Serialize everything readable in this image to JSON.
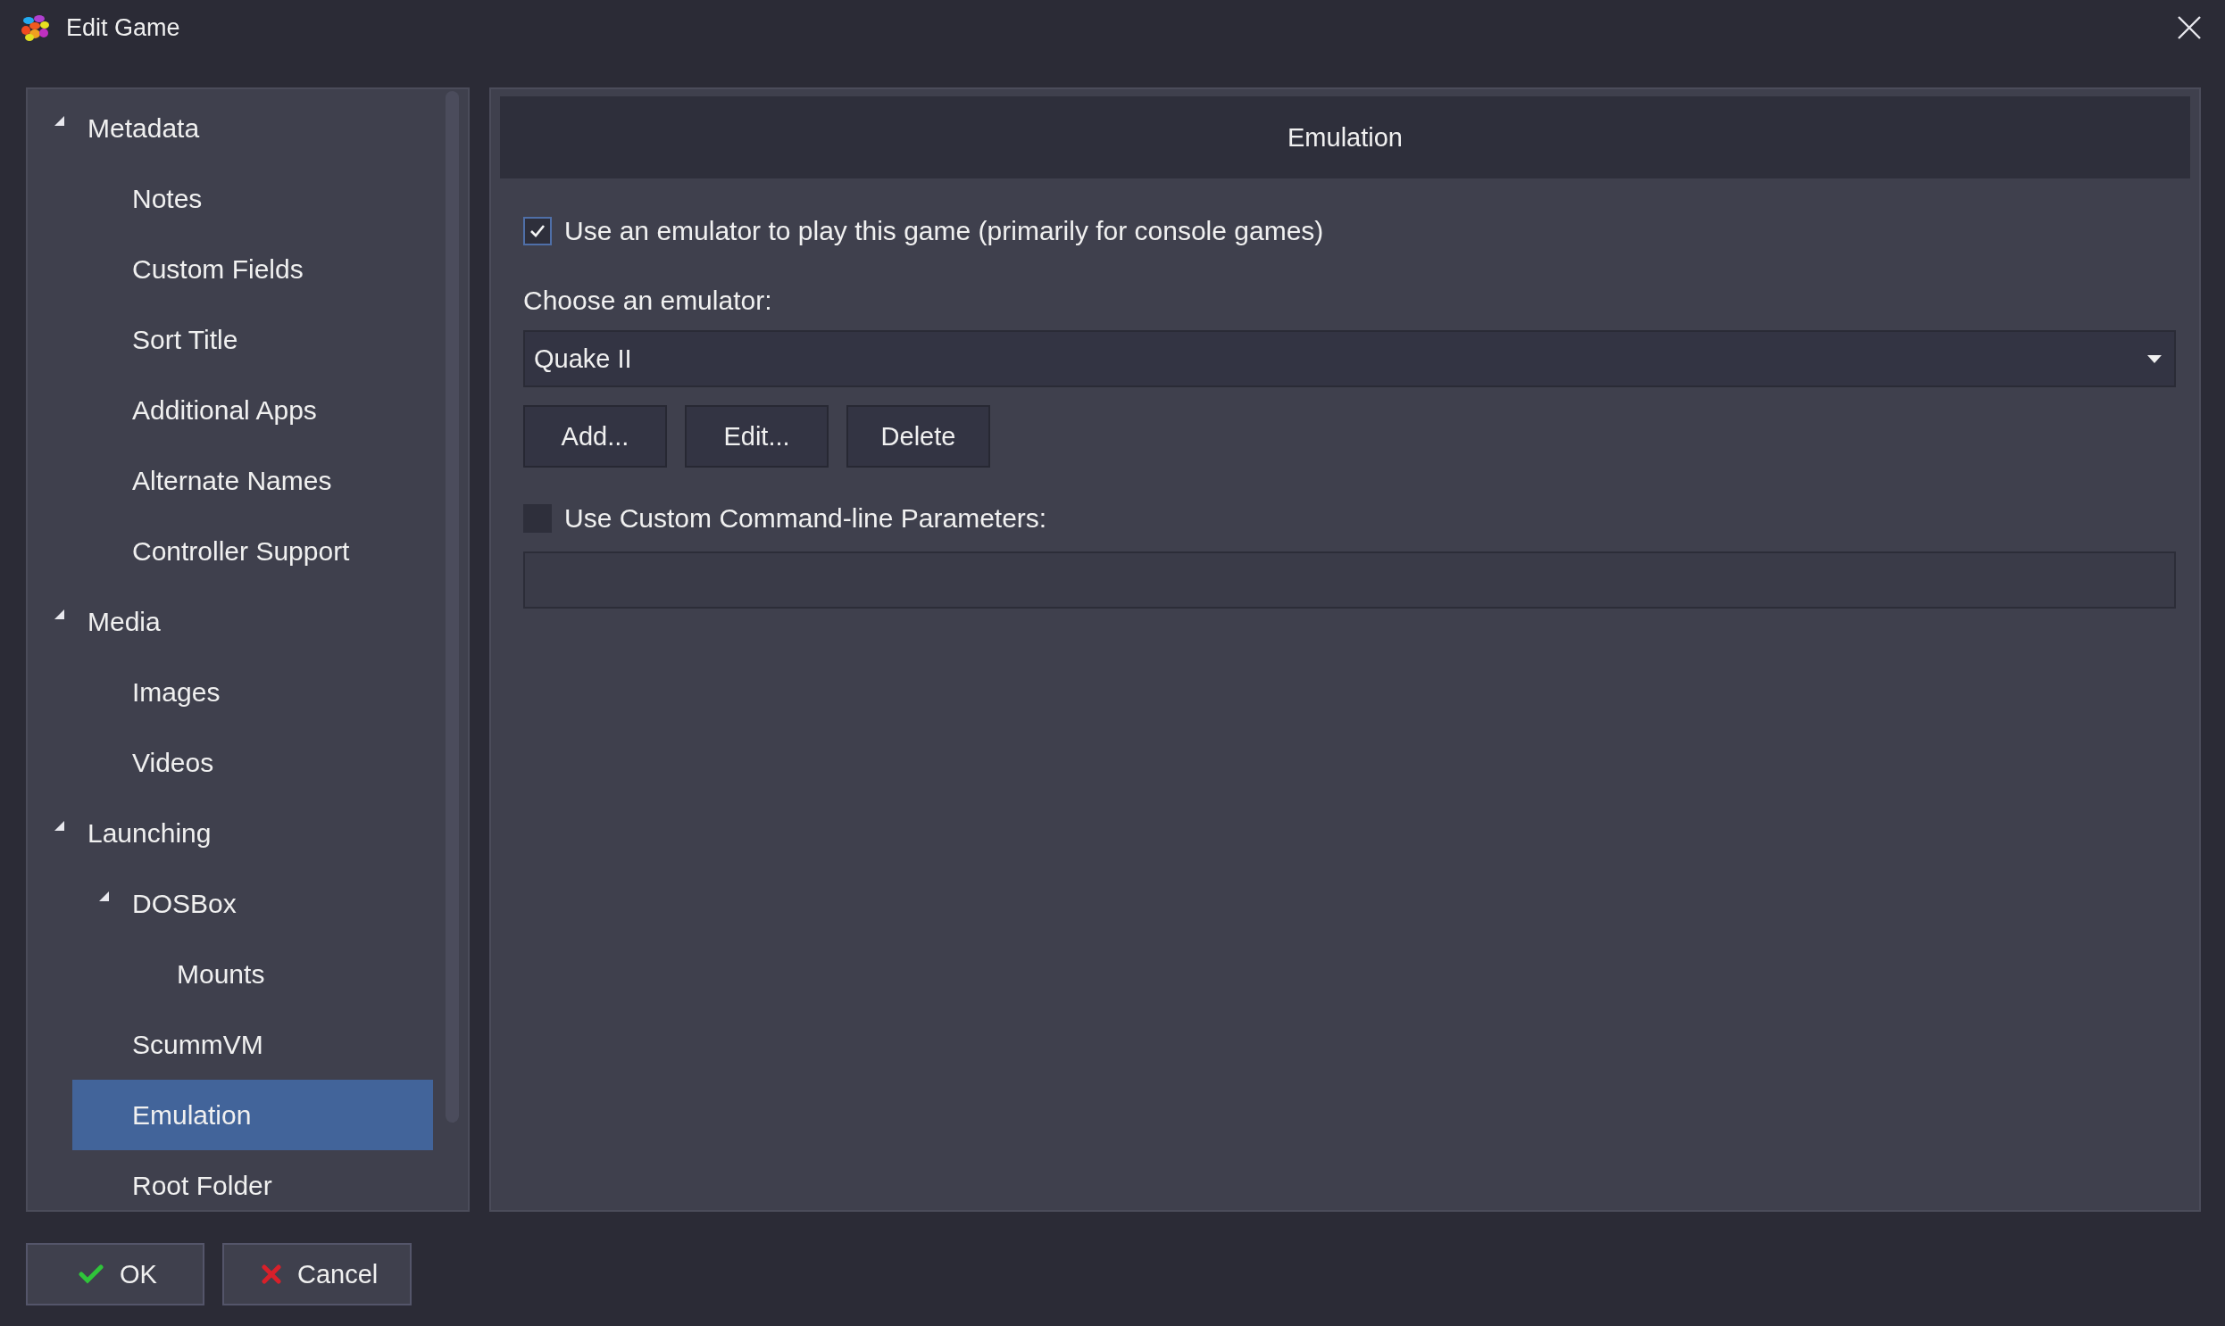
{
  "window": {
    "title": "Edit Game"
  },
  "tree": [
    {
      "label": "Metadata",
      "expanded": true,
      "selected": false,
      "children": [
        {
          "label": "Notes",
          "selected": false
        },
        {
          "label": "Custom Fields",
          "selected": false
        },
        {
          "label": "Sort Title",
          "selected": false
        },
        {
          "label": "Additional Apps",
          "selected": false
        },
        {
          "label": "Alternate Names",
          "selected": false
        },
        {
          "label": "Controller Support",
          "selected": false
        }
      ]
    },
    {
      "label": "Media",
      "expanded": true,
      "selected": false,
      "children": [
        {
          "label": "Images",
          "selected": false
        },
        {
          "label": "Videos",
          "selected": false
        }
      ]
    },
    {
      "label": "Launching",
      "expanded": true,
      "selected": false,
      "children": [
        {
          "label": "DOSBox",
          "expanded": true,
          "selected": false,
          "children": [
            {
              "label": "Mounts",
              "selected": false
            }
          ]
        },
        {
          "label": "ScummVM",
          "selected": false
        },
        {
          "label": "Emulation",
          "selected": true
        },
        {
          "label": "Root Folder",
          "selected": false
        }
      ]
    }
  ],
  "panel": {
    "header": "Emulation",
    "use_emulator": {
      "label": "Use an emulator to play this game (primarily for console games)",
      "checked": true
    },
    "emulator_label": "Choose an emulator:",
    "emulator": {
      "value": "Quake II"
    },
    "buttons": [
      "Add...",
      "Edit...",
      "Delete"
    ],
    "custom_params": {
      "label": "Use Custom Command-line Parameters:",
      "checked": false
    }
  },
  "footer": {
    "buttons": [
      {
        "label": "OK",
        "kind": "ok"
      },
      {
        "label": "Cancel",
        "kind": "cancel"
      }
    ]
  }
}
